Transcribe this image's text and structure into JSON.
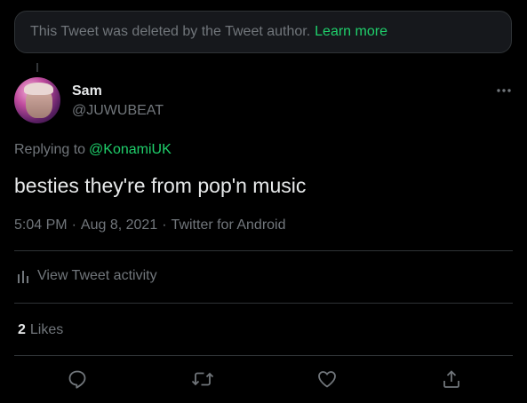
{
  "deleted_notice": {
    "text": "This Tweet was deleted by the Tweet author.",
    "link": "Learn more"
  },
  "author": {
    "name": "Sam",
    "handle": "@JUWUBEAT"
  },
  "reply": {
    "prefix": "Replying to",
    "mention": "@KonamiUK"
  },
  "tweet": {
    "text": "besties they're from pop'n music",
    "time": "5:04 PM",
    "sep1": "·",
    "date": "Aug 8, 2021",
    "sep2": "·",
    "source": "Twitter for Android"
  },
  "activity": {
    "label": "View Tweet activity"
  },
  "likes": {
    "count": "2",
    "label": "Likes"
  },
  "actions": [
    "reply-icon",
    "retweet-icon",
    "like-icon",
    "share-icon"
  ],
  "colors": {
    "accent": "#1fcf6b",
    "muted": "#71767b",
    "text": "#e7e9ea",
    "background": "#000000"
  }
}
